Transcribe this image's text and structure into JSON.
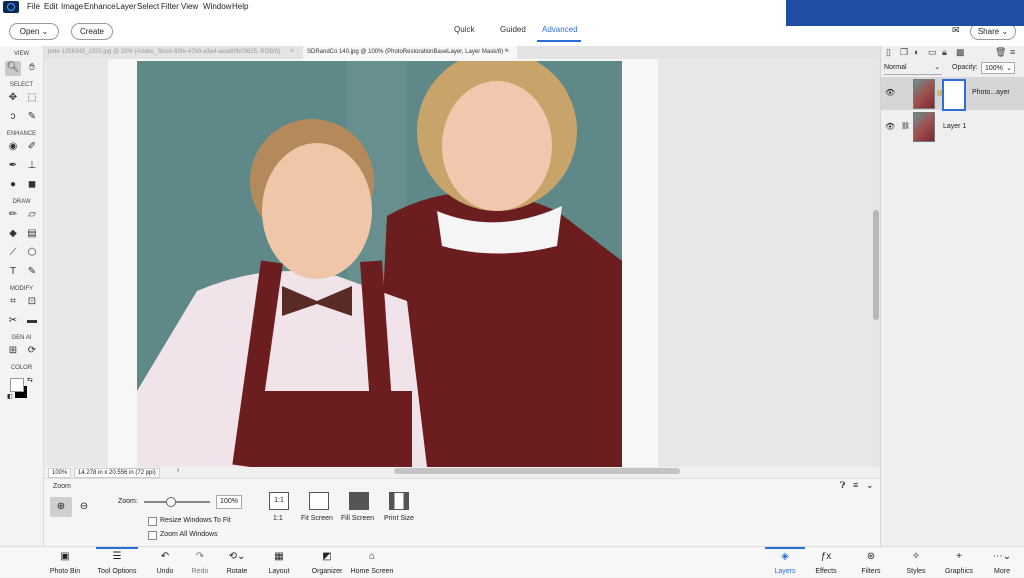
{
  "menu": [
    "File",
    "Edit",
    "Image",
    "Enhance",
    "Layer",
    "Select",
    "Filter",
    "View",
    "Window",
    "Help"
  ],
  "topbar": {
    "open_label": "Open",
    "create_label": "Create",
    "share_label": "Share",
    "modes": [
      "Quick",
      "Guided",
      "Advanced"
    ],
    "active_mode": "Advanced"
  },
  "toolbar": {
    "sections": [
      "VIEW",
      "SELECT",
      "ENHANCE",
      "DRAW",
      "MODIFY",
      "GEN AI",
      "COLOR"
    ]
  },
  "tabs": [
    {
      "label": "pete-1356345_1920.jpg @ 33% (Adobe_Stock-63fe-47b9-a3a4-aead0fb03625, RGB/8)",
      "close": "×",
      "active": false
    },
    {
      "label": "SDRandCo 140.jpg @ 100% (PhotoRestorationBaseLayer, Layer Mask/8) *",
      "close": "×",
      "active": true
    }
  ],
  "status": {
    "zoom": "100%",
    "size": "14.278 in x 20.556 in (72 ppi)"
  },
  "tool_options": {
    "title": "Zoom",
    "zoom_label": "Zoom:",
    "zoom_value": "100%",
    "resize_windows": "Resize Windows To Fit",
    "zoom_all": "Zoom All Windows",
    "buttons": [
      {
        "icon": "1:1",
        "label": "1:1"
      },
      {
        "label": "Fit Screen"
      },
      {
        "label": "Fill Screen"
      },
      {
        "label": "Print Size"
      }
    ]
  },
  "bottom_bar": {
    "left": [
      "Photo Bin",
      "Tool Options",
      "Undo",
      "Redo",
      "Rotate",
      "Layout",
      "Organizer",
      "Home Screen"
    ],
    "right": [
      "Layers",
      "Effects",
      "Filters",
      "Styles",
      "Graphics",
      "More"
    ]
  },
  "layers_panel": {
    "blend_mode": "Normal",
    "opacity_label": "Opacity:",
    "opacity_value": "100%",
    "layers": [
      {
        "name": "Photo...ayer",
        "selected": true
      },
      {
        "name": "Layer 1",
        "selected": false
      }
    ]
  },
  "colors": {
    "accent": "#2b6fd6",
    "overlay": "#1f4ea3"
  }
}
